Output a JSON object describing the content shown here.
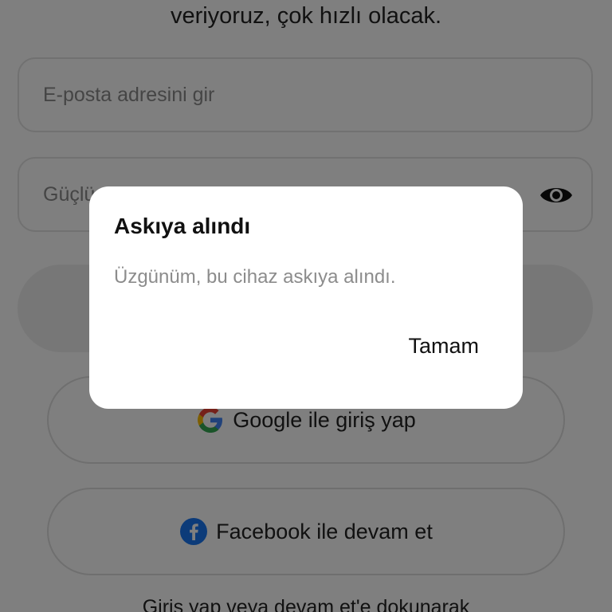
{
  "signup": {
    "subtitle": "veriyoruz, çok hızlı olacak.",
    "email_placeholder": "E-posta adresini gir",
    "password_placeholder": "Güçlü",
    "password_visibility_icon": "eye-icon",
    "login_button_label": "",
    "google_button_label": "Google ile giriş yap",
    "facebook_button_label": "Facebook ile devam et",
    "terms_text": "Giriş yap veya devam et'e dokunarak"
  },
  "dialog": {
    "title": "Askıya alındı",
    "message": "Üzgünüm, bu cihaz askıya alındı.",
    "ok_label": "Tamam"
  },
  "colors": {
    "overlay": "rgba(0,0,0,0.5)",
    "facebook_blue": "#1877F2",
    "google_blue": "#4285F4",
    "google_red": "#EA4335",
    "google_yellow": "#FBBC05",
    "google_green": "#34A853"
  }
}
